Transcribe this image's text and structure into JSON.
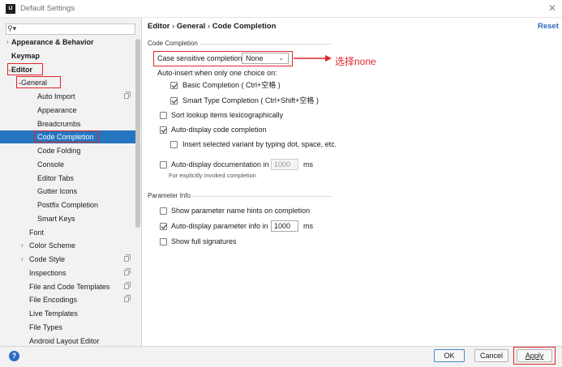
{
  "window": {
    "title": "Default Settings",
    "icon_label": "IJ"
  },
  "search": {
    "icon": "search-icon"
  },
  "sidebar": {
    "items": [
      {
        "label": "Appearance & Behavior",
        "bold": true,
        "arrow": "›"
      },
      {
        "label": "Keymap",
        "bold": true
      },
      {
        "label": "Editor",
        "bold": true,
        "arrow": "⌄"
      },
      {
        "label": "General",
        "arrow": "⌄"
      },
      {
        "label": "Auto Import",
        "copy": true
      },
      {
        "label": "Appearance"
      },
      {
        "label": "Breadcrumbs"
      },
      {
        "label": "Code Completion",
        "selected": true
      },
      {
        "label": "Code Folding"
      },
      {
        "label": "Console"
      },
      {
        "label": "Editor Tabs"
      },
      {
        "label": "Gutter Icons"
      },
      {
        "label": "Postfix Completion"
      },
      {
        "label": "Smart Keys"
      },
      {
        "label": "Font"
      },
      {
        "label": "Color Scheme",
        "arrow": "›"
      },
      {
        "label": "Code Style",
        "arrow": "›",
        "copy": true
      },
      {
        "label": "Inspections",
        "copy": true
      },
      {
        "label": "File and Code Templates",
        "copy": true
      },
      {
        "label": "File Encodings",
        "copy": true
      },
      {
        "label": "Live Templates"
      },
      {
        "label": "File Types"
      },
      {
        "label": "Android Layout Editor"
      }
    ]
  },
  "breadcrumb": {
    "part1": "Editor",
    "sep": "›",
    "part2": "General",
    "part3": "Code Completion"
  },
  "reset_label": "Reset",
  "code_completion": {
    "group_title": "Code Completion",
    "case_label": "Case sensitive completion:",
    "case_value": "None",
    "auto_insert_label": "Auto-insert when only one choice on:",
    "basic": "Basic Completion ( Ctrl+空格 )",
    "smart": "Smart Type Completion ( Ctrl+Shift+空格 )",
    "sort": "Sort lookup items lexicographically",
    "auto_display": "Auto-display code completion",
    "insert_selected": "Insert selected variant by typing dot, space, etc.",
    "auto_doc": "Auto-display documentation in",
    "auto_doc_value": "1000",
    "auto_doc_unit": "ms",
    "auto_doc_hint": "For explicitly invoked completion"
  },
  "parameter_info": {
    "group_title": "Parameter Info",
    "show_hints": "Show parameter name hints on completion",
    "auto_param": "Auto-display parameter info in",
    "auto_param_value": "1000",
    "auto_param_unit": "ms",
    "full_sig": "Show full signatures"
  },
  "annotation": {
    "text": "选择none",
    "color": "#e0262b"
  },
  "buttons": {
    "ok": "OK",
    "cancel": "Cancel",
    "apply": "Apply"
  },
  "colors": {
    "selection": "#2675bf",
    "annotation_red": "#e0262b",
    "link": "#2a6bbf"
  }
}
